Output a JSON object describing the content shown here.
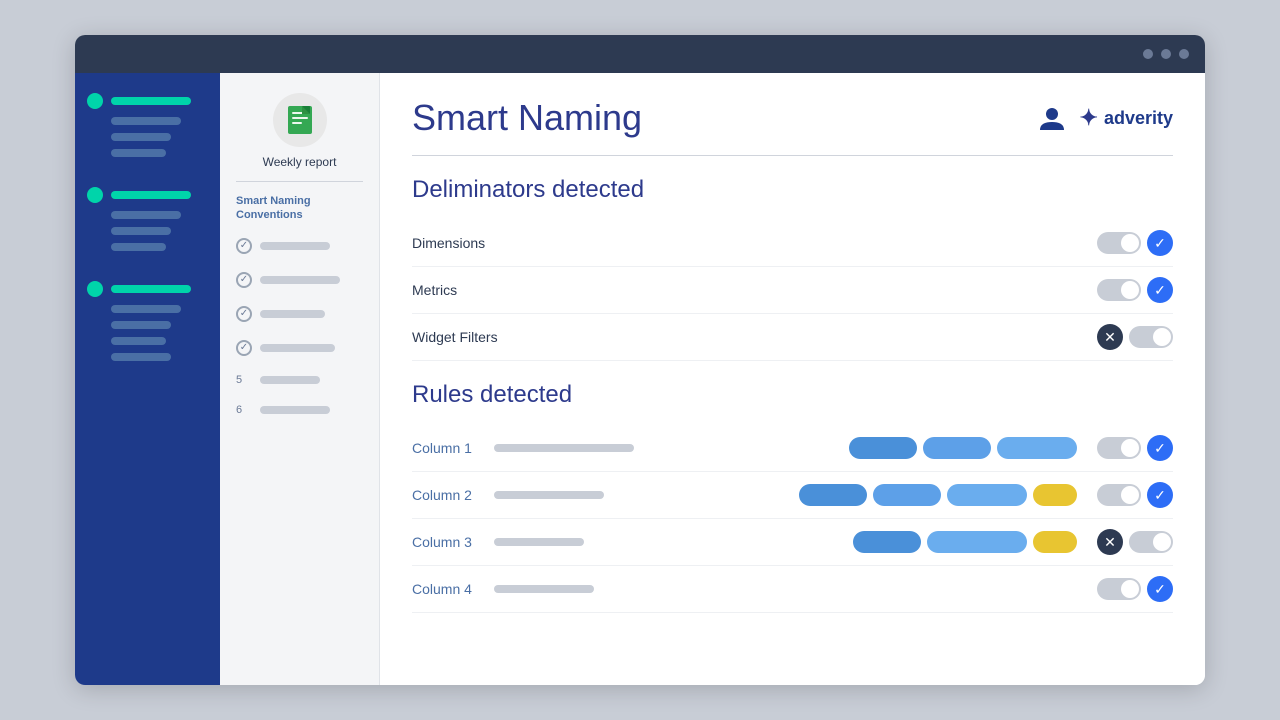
{
  "window": {
    "titlebar": {
      "dots": [
        "dot1",
        "dot2",
        "dot3"
      ]
    }
  },
  "brand": {
    "logo_text": "adverity",
    "logo_icon": "✦"
  },
  "user": {
    "icon": "👤"
  },
  "secondary_sidebar": {
    "report_label": "Weekly report",
    "nav_label_line1": "Smart Naming",
    "nav_label_line2": "Conventions",
    "items": [
      {
        "type": "check",
        "bar_class": "w1"
      },
      {
        "type": "check",
        "bar_class": "w2"
      },
      {
        "type": "check",
        "bar_class": "w3"
      },
      {
        "type": "check",
        "bar_class": "w4"
      },
      {
        "type": "number",
        "num": "5",
        "bar_class": "w5"
      },
      {
        "type": "number",
        "num": "6",
        "bar_class": "w6"
      }
    ]
  },
  "main": {
    "page_title": "Smart Naming",
    "section1_heading": "Deliminators detected",
    "delimiters": [
      {
        "label": "Dimensions",
        "state": "check"
      },
      {
        "label": "Metrics",
        "state": "check"
      },
      {
        "label": "Widget Filters",
        "state": "x"
      }
    ],
    "section2_heading": "Rules  detected",
    "columns": [
      {
        "label": "Column 1",
        "bar_class": "long",
        "tags": [
          "blue",
          "blue2",
          "blue3"
        ],
        "state": "check"
      },
      {
        "label": "Column 2",
        "bar_class": "med",
        "tags": [
          "blue",
          "blue2",
          "blue3",
          "yellow"
        ],
        "state": "check"
      },
      {
        "label": "Column 3",
        "bar_class": "short",
        "tags": [
          "blue",
          "blue3",
          "yellow"
        ],
        "state": "x"
      },
      {
        "label": "Column 4",
        "bar_class": "xshort",
        "tags": [],
        "state": "check"
      }
    ]
  },
  "sidebar": {
    "sections": [
      {
        "dot": true,
        "active_bar": "active",
        "sub_bars": [
          "w1",
          "w2",
          "w3"
        ]
      },
      {
        "dot": true,
        "active_bar": "active",
        "sub_bars": [
          "w1",
          "w2",
          "w3"
        ]
      },
      {
        "dot": true,
        "active_bar": "active",
        "sub_bars": [
          "w1",
          "w2",
          "w3",
          "w2"
        ]
      }
    ]
  }
}
